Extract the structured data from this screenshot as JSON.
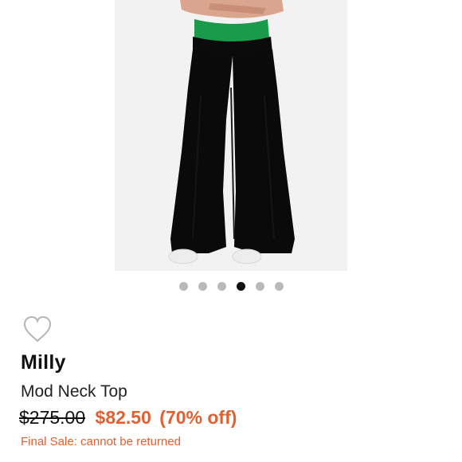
{
  "product": {
    "image_alt": "Black wide leg pants with green top",
    "carousel": {
      "count": 6,
      "active_index": 3
    },
    "brand": "Milly",
    "title": "Mod Neck Top",
    "original_price": "$275.00",
    "sale_price": "$82.50",
    "discount": "(70% off)",
    "final_sale_note": "Final Sale: cannot be returned"
  },
  "icons": {
    "favorite": "heart-outline-icon"
  },
  "colors": {
    "sale": "#e0602f",
    "dot_active": "#111111",
    "dot_inactive": "#b9b9b9"
  }
}
